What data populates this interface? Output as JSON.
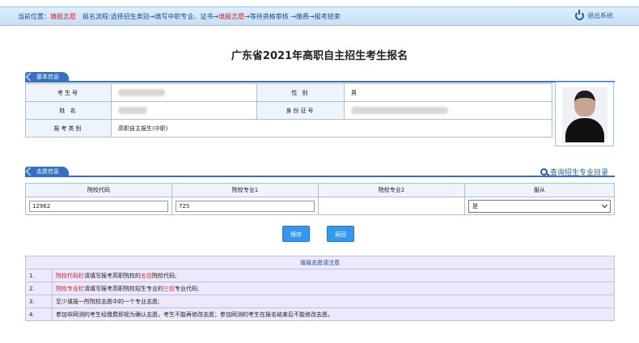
{
  "topbar": {
    "location_label": "当前位置：",
    "location_value": "填报志愿",
    "process_prefix": "报名流程:选择招生类别→填写中职专业、证书→",
    "process_current": "填报志愿",
    "process_suffix": "→等待资格审核 →缴费→报考结束",
    "logout": "退出系统"
  },
  "title": "广东省2021年高职自主招生考生报名",
  "basic_info": {
    "tab": "基本信息",
    "exam_no_label": "考生号",
    "gender_label": "性 别",
    "gender_value": "男",
    "name_label": "姓 名",
    "id_label": "身份证号",
    "type_label": "报考类别",
    "type_value": "高职自主报生(中职)"
  },
  "choice_info": {
    "tab": "志愿信息",
    "query_link": "查询招生专业目录",
    "headers": [
      "院校代码",
      "院校专业1",
      "院校专业2",
      "服从"
    ],
    "school_code": "12962",
    "major1": "725",
    "major2": "",
    "obey": "是"
  },
  "buttons": {
    "save": "保存",
    "back": "返回"
  },
  "notes": {
    "header": "填报志愿请注意",
    "items": [
      {
        "no": "1.",
        "p1": "院校代码栏",
        "p2": "请填写报考高职院校的",
        "p3": "五位",
        "p4": "院校代码;"
      },
      {
        "no": "2.",
        "p1": "院校专业栏",
        "p2": "请填写报考高职院校招生专业的",
        "p3": "三位",
        "p4": "专业代码;"
      },
      {
        "no": "3.",
        "text": "至少填报一所院校志愿中的一个专业志愿;"
      },
      {
        "no": "4.",
        "text": "参加非网测的考生经缴费即视为确认志愿，考生不能再修改志愿；参加网测的考生在报名结束后不能修改志愿。"
      }
    ]
  },
  "colors": {
    "accent": "#3570c4",
    "button": "#3399ee",
    "highlight": "#e02020",
    "notes_bg": "#ede9fb"
  }
}
